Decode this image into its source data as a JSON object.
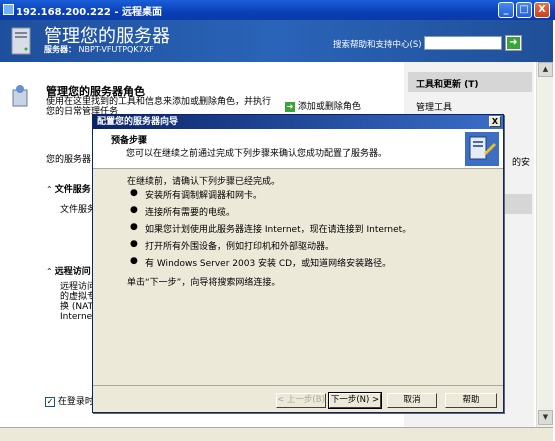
{
  "remote_title": "192.168.200.222 - 远程桌面",
  "window_buttons": {
    "minimize": "_",
    "restore": "□",
    "close": "X"
  },
  "banner": {
    "title": "管理您的服务器",
    "server_label": "服务器：",
    "server_name": "NBPT-VFUTPQK7XF",
    "search_label": "搜索帮助和支持中心(S)",
    "search_value": ""
  },
  "main": {
    "heading": "管理您的服务器角色",
    "description": "使用在这里找到的工具和信息来添加或删除角色，并执行您的日常管理任务",
    "add_remove_link": "添加或删除角色",
    "server_line": "您的服务器已",
    "section1_title": "文件服务",
    "section1_text": "文件服务器",
    "section2_title": "远程访问",
    "section2_lines": [
      "远程访问，",
      "的虚拟专",
      "换 (NAT)，",
      "Internet"
    ],
    "checkbox_label": "在登录时不"
  },
  "right_panel": {
    "tools_title": "工具和更新 (T)",
    "admin_tools": "管理工具",
    "cut_text": "的安"
  },
  "dialog": {
    "title": "配置您的服务器向导",
    "close": "X",
    "head_title": "预备步骤",
    "head_subtitle": "您可以在继续之前通过完成下列步骤来确认您成功配置了服务器。",
    "intro": "在继续前，请确认下列步骤已经完成。",
    "bullet": "●",
    "steps": [
      "安装所有调制解调器和网卡。",
      "连接所有需要的电缆。",
      "如果您计划使用此服务器连接 Internet，现在请连接到 Internet。",
      "打开所有外围设备，例如打印机和外部驱动器。",
      "有 Windows Server 2003 安装 CD，或知道网络安装路径。"
    ],
    "footer": "单击“下一步”，向导将搜索网络连接。",
    "buttons": {
      "back": "< 上一步(B)",
      "next": "下一步(N) >",
      "cancel": "取消",
      "help": "帮助"
    }
  },
  "colors": {
    "banner": "#2a64b8",
    "titlebar": "#0a3fb8",
    "dialog_title": "#0a246a"
  }
}
